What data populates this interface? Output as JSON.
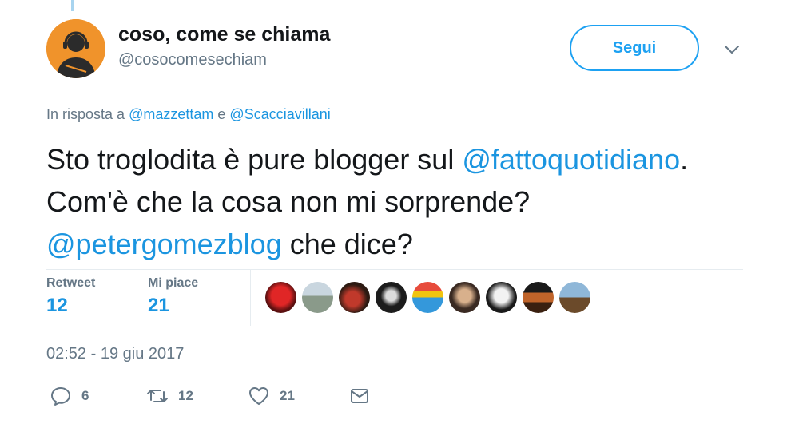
{
  "user": {
    "display_name": "coso, come se chiama",
    "handle": "@cosocomesechiam",
    "avatar_icon": "person-with-headphones-icon",
    "avatar_color": "#f0932b"
  },
  "follow_button": {
    "label": "Segui"
  },
  "menu_icon": "chevron-down-icon",
  "reply_to": {
    "prefix": "In risposta a",
    "mention1": "@mazzettam",
    "conjunction": "e",
    "mention2": "@Scacciavillani"
  },
  "tweet": {
    "part1": "Sto troglodita è pure blogger sul",
    "mention1": "@fattoquotidiano",
    "part2": ". Com'è che la cosa non mi sorprende?",
    "mention2": "@petergomezblog",
    "part3": "che dice?"
  },
  "stats": {
    "retweet_label": "Retweet",
    "retweet_count": "12",
    "like_label": "Mi piace",
    "like_count": "21"
  },
  "likers_count_shown": 9,
  "timestamp": "02:52 - 19 giu 2017",
  "actions": {
    "reply_icon": "reply-icon",
    "reply_count": "6",
    "retweet_icon": "retweet-icon",
    "retweet_count": "12",
    "like_icon": "heart-icon",
    "like_count": "21",
    "dm_icon": "envelope-icon"
  },
  "colors": {
    "accent": "#1da1f2",
    "link": "#1b95e0",
    "muted": "#657786",
    "text": "#14171a"
  }
}
